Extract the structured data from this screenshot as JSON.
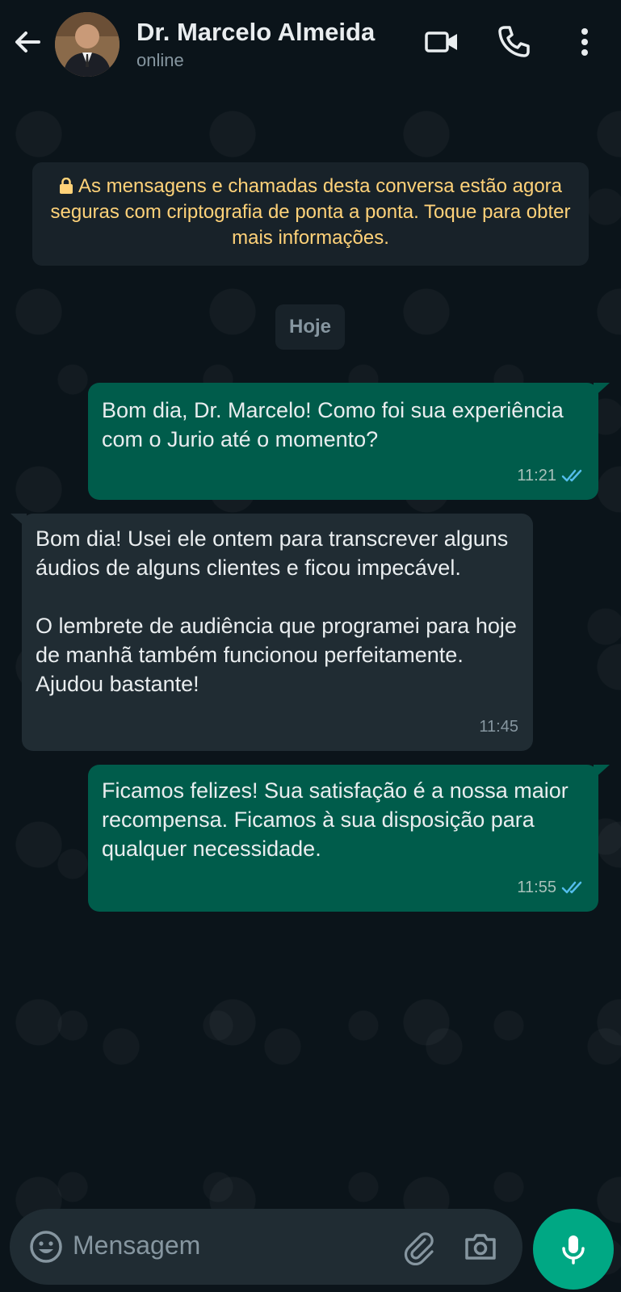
{
  "header": {
    "contact_name": "Dr. Marcelo Almeida",
    "status": "online"
  },
  "notice": {
    "text": "As mensagens e chamadas desta conversa estão agora seguras com criptografia de ponta a ponta. Toque para obter mais informações."
  },
  "date_chip": "Hoje",
  "messages": [
    {
      "direction": "out",
      "text": "Bom dia, Dr. Marcelo! Como foi sua experiência com o Jurio até o momento?",
      "time": "11:21",
      "status": "read"
    },
    {
      "direction": "in",
      "text": "Bom dia! Usei ele ontem para transcrever alguns áudios de alguns clientes e ficou impecável.\n\nO lembrete de audiência que programei para hoje de manhã também funcionou perfeitamente. Ajudou bastante!",
      "time": "11:45"
    },
    {
      "direction": "out",
      "text": "Ficamos felizes! Sua satisfação é a nossa maior recompensa. Ficamos à sua disposição para qualquer necessidade.",
      "time": "11:55",
      "status": "read"
    }
  ],
  "input": {
    "placeholder": "Mensagem"
  },
  "colors": {
    "outgoing_bubble": "#005c4b",
    "incoming_bubble": "#202c33",
    "notice_text": "#ffd279",
    "read_tick": "#53bdeb",
    "accent": "#00a884"
  }
}
